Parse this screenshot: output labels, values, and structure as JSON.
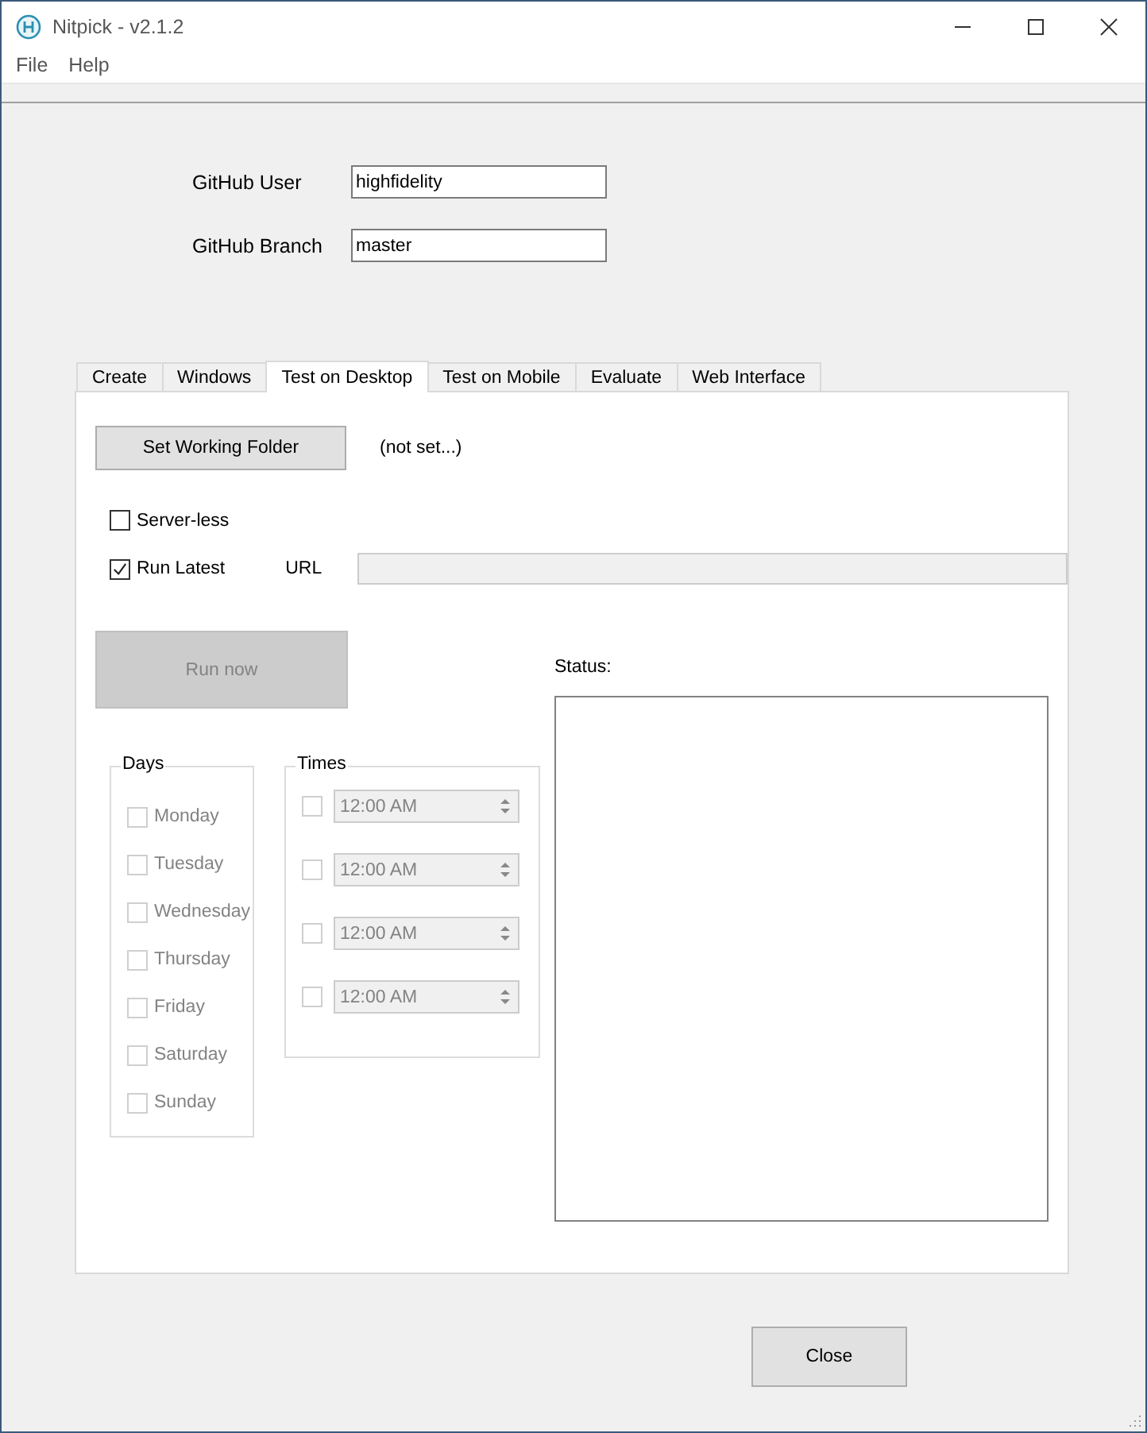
{
  "window": {
    "title": "Nitpick - v2.1.2"
  },
  "menu": [
    {
      "label": "File"
    },
    {
      "label": "Help"
    }
  ],
  "github": {
    "user_label": "GitHub User",
    "user": "highfidelity",
    "branch_label": "GitHub Branch",
    "branch": "master"
  },
  "tabs": [
    {
      "label": "Create",
      "selected": false
    },
    {
      "label": "Windows",
      "selected": false
    },
    {
      "label": "Test on Desktop",
      "selected": true
    },
    {
      "label": "Test on Mobile",
      "selected": false
    },
    {
      "label": "Evaluate",
      "selected": false
    },
    {
      "label": "Web Interface",
      "selected": false
    }
  ],
  "working_folder": {
    "button": "Set Working Folder",
    "value": "(not set...)"
  },
  "server_less": {
    "label": "Server-less",
    "checked": false
  },
  "run_latest": {
    "label": "Run Latest",
    "checked": true
  },
  "url": {
    "label": "URL",
    "disabled": true
  },
  "run_now": {
    "label": "Run now",
    "disabled": true
  },
  "status_label": "Status:",
  "days": {
    "title": "Days",
    "disabled": true,
    "items": [
      {
        "label": "Monday",
        "checked": false
      },
      {
        "label": "Tuesday",
        "checked": false
      },
      {
        "label": "Wednesday",
        "checked": false
      },
      {
        "label": "Thursday",
        "checked": false
      },
      {
        "label": "Friday",
        "checked": false
      },
      {
        "label": "Saturday",
        "checked": false
      },
      {
        "label": "Sunday",
        "checked": false
      }
    ]
  },
  "times": {
    "title": "Times",
    "disabled": true,
    "items": [
      {
        "value": "12:00 AM",
        "checked": false
      },
      {
        "value": "12:00 AM",
        "checked": false
      },
      {
        "value": "12:00 AM",
        "checked": false
      },
      {
        "value": "12:00 AM",
        "checked": false
      }
    ]
  },
  "close_button": "Close"
}
